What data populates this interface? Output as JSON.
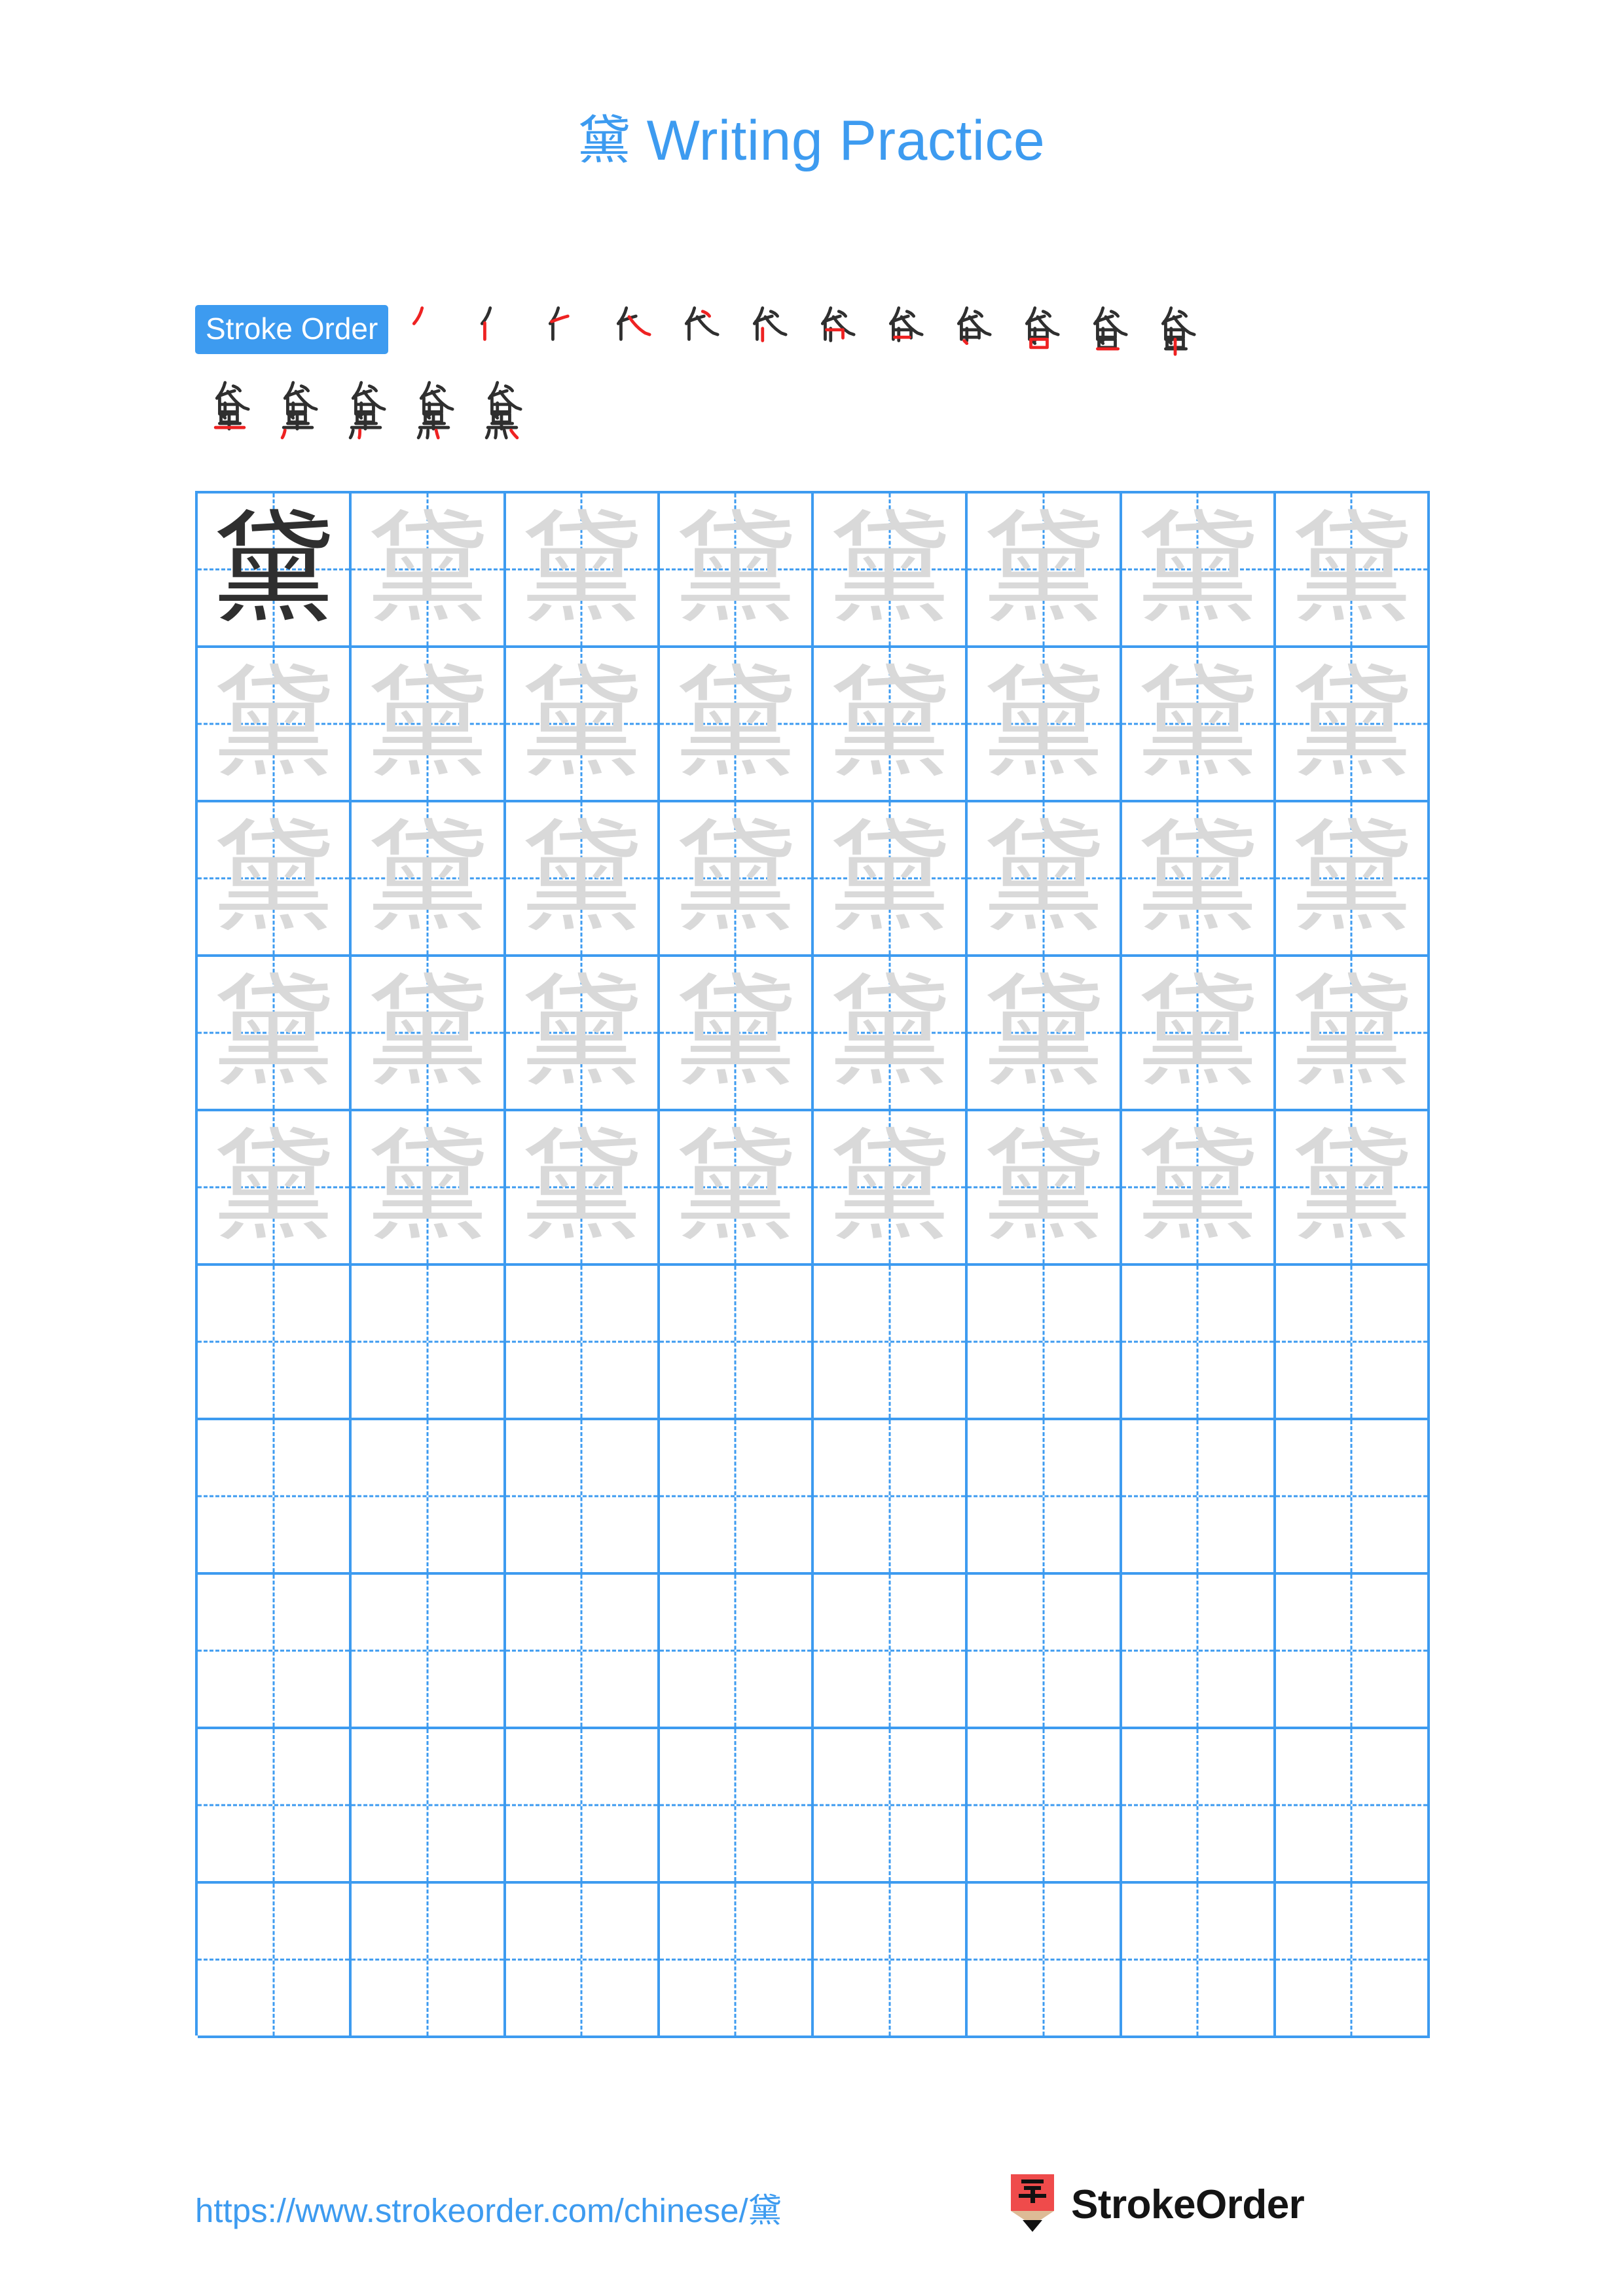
{
  "page": {
    "character": "黛",
    "title_suffix": "Writing Practice",
    "background": "#ffffff"
  },
  "colors": {
    "accent_blue": "#3d9bf0",
    "grid_blue": "#3d9bf0",
    "trace_gray": "#d9d9d9",
    "ink_dark": "#2f2f2f",
    "stroke_highlight_red": "#ee2222",
    "logo_red": "#ef4b4b",
    "logo_wood": "#ddbb96",
    "logo_tip": "#111111"
  },
  "stroke_order": {
    "badge_label": "Stroke Order",
    "total_strokes": 17,
    "row1_count": 12,
    "row2_count": 5
  },
  "grid": {
    "columns": 8,
    "rows": 10,
    "filled_rows": 5,
    "empty_rows": 5,
    "first_cell_dark": true,
    "glyph": "黛"
  },
  "footer": {
    "url": "https://www.strokeorder.com/chinese/",
    "url_char": "黛",
    "brand_name": "StrokeOrder",
    "brand_logo_char": "字"
  }
}
